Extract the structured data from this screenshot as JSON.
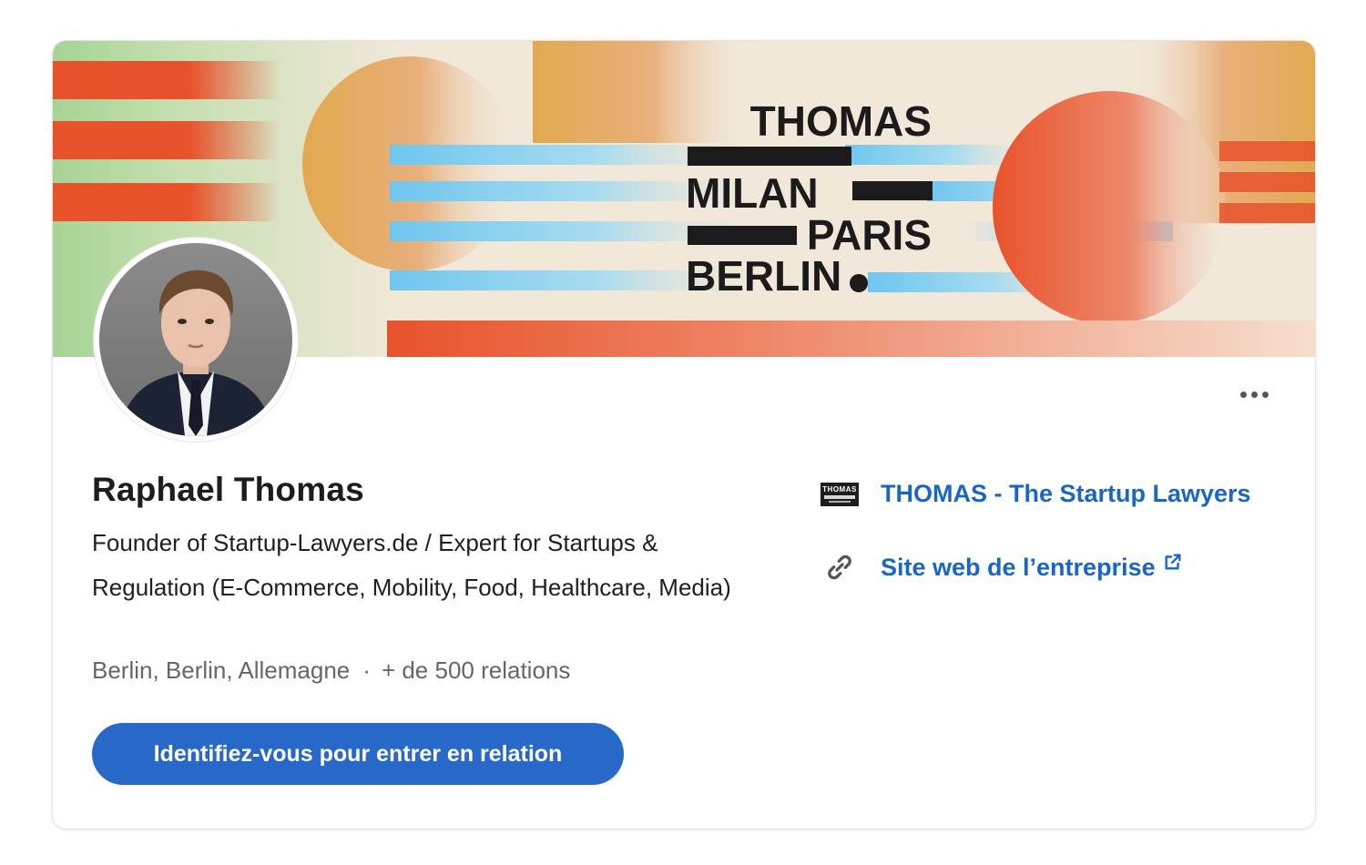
{
  "banner": {
    "lines": [
      "THOMAS",
      "MILAN",
      "PARIS",
      "BERLIN"
    ]
  },
  "profile": {
    "name": "Raphael Thomas",
    "headline": "Founder of Startup-Lawyers.de / Expert for Startups & Regulation (E-Commerce, Mobility, Food, Healthcare, Media)",
    "location": "Berlin, Berlin, Allemagne",
    "separator": "·",
    "connections": "+ de 500 relations",
    "cta_label": "Identifiez-vous pour entrer en relation"
  },
  "side": {
    "company_label": "THOMAS - The Startup Lawyers",
    "company_logo_text": "THOMAS",
    "website_label": "Site web de l’entreprise"
  },
  "icons": {
    "more": "ellipsis-icon",
    "company": "company-logo-icon",
    "website": "link-icon",
    "external": "external-link-icon"
  },
  "colors": {
    "accent_blue": "#2768c9",
    "link_blue": "#1a66c4",
    "banner_orange": "#e8522b",
    "banner_light_blue": "#6ec6ef"
  }
}
